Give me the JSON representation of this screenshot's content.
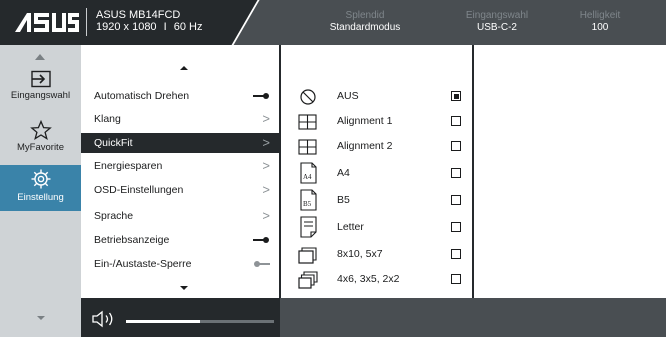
{
  "header": {
    "logo": "ASUS",
    "model": "ASUS MB14FCD",
    "resolution": "1920 x 1080",
    "separator": "I",
    "refresh": "60 Hz",
    "columns": [
      {
        "title": "Splendid",
        "value": "Standardmodus"
      },
      {
        "title": "Eingangswahl",
        "value": "USB-C-2"
      },
      {
        "title": "Helligkeit",
        "value": "100"
      }
    ]
  },
  "leftnav": {
    "items": [
      {
        "label": "Eingangswahl",
        "icon": "input-icon"
      },
      {
        "label": "MyFavorite",
        "icon": "star-icon"
      },
      {
        "label": "Einstellung",
        "icon": "gear-icon"
      }
    ],
    "active_index": 2
  },
  "submenu": {
    "items": [
      {
        "label": "Automatisch Drehen",
        "control": "toggle",
        "state": "on"
      },
      {
        "label": "Klang",
        "control": "chevron"
      },
      {
        "label": "QuickFit",
        "control": "chevron"
      },
      {
        "label": "Energiesparen",
        "control": "chevron"
      },
      {
        "label": "OSD-Einstellungen",
        "control": "chevron"
      },
      {
        "label": "Sprache",
        "control": "chevron"
      },
      {
        "label": "Betriebsanzeige",
        "control": "toggle",
        "state": "on"
      },
      {
        "label": "Ein-/Austaste-Sperre",
        "control": "toggle",
        "state": "off"
      }
    ],
    "active_index": 2,
    "chevron_glyph": ">"
  },
  "options": {
    "items": [
      {
        "label": "AUS",
        "icon": "off-circle-icon",
        "selected": true
      },
      {
        "label": "Alignment 1",
        "icon": "alignment-grid-icon",
        "selected": false
      },
      {
        "label": "Alignment 2",
        "icon": "alignment-grid-icon",
        "selected": false
      },
      {
        "label": "A4",
        "icon": "paper-a4-icon",
        "icon_text": "A4",
        "selected": false
      },
      {
        "label": "B5",
        "icon": "paper-b5-icon",
        "icon_text": "B5",
        "selected": false
      },
      {
        "label": "Letter",
        "icon": "paper-letter-icon",
        "selected": false
      },
      {
        "label": "8x10, 5x7",
        "icon": "photo-frames-two-icon",
        "selected": false
      },
      {
        "label": "4x6, 3x5, 2x2",
        "icon": "photo-frames-three-icon",
        "selected": false
      }
    ]
  },
  "volume": {
    "icon": "speaker-icon",
    "level": 0.5
  },
  "colors": {
    "header_dark": "#25292c",
    "header_mid": "#494e52",
    "nav_bg": "#cfd3d6",
    "accent": "#3a83a9",
    "text_dark": "#1b1c1d"
  }
}
